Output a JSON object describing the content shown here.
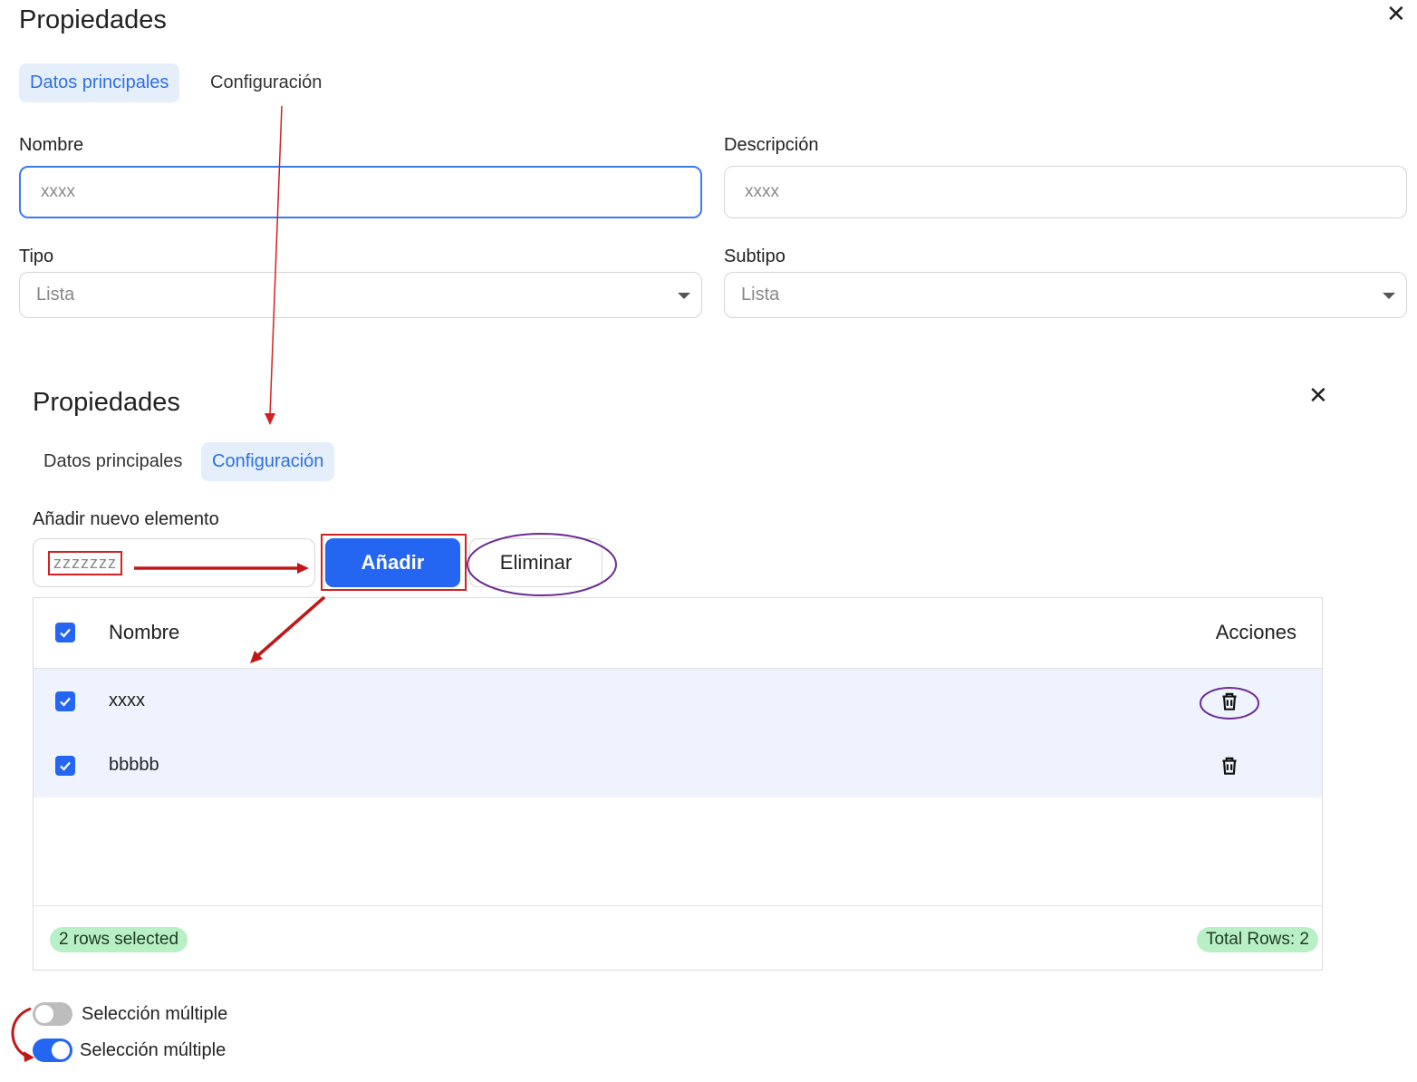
{
  "top_panel": {
    "title": "Propiedades",
    "close_icon": "close-icon",
    "tabs": [
      {
        "label": "Datos principales",
        "active": true
      },
      {
        "label": "Configuración",
        "active": false
      }
    ],
    "fields": {
      "nombre_label": "Nombre",
      "nombre_placeholder": "xxxx",
      "descripcion_label": "Descripción",
      "descripcion_placeholder": "xxxx",
      "tipo_label": "Tipo",
      "tipo_value": "Lista",
      "subtipo_label": "Subtipo",
      "subtipo_value": "Lista"
    }
  },
  "bottom_panel": {
    "title": "Propiedades",
    "close_icon": "close-icon",
    "tabs": [
      {
        "label": "Datos principales",
        "active": false
      },
      {
        "label": "Configuración",
        "active": true
      }
    ],
    "add_label": "Añadir nuevo elemento",
    "add_input_value": "zzzzzzz",
    "add_button": "Añadir",
    "delete_button": "Eliminar",
    "table": {
      "headers": {
        "name": "Nombre",
        "actions": "Acciones"
      },
      "rows": [
        {
          "name": "xxxx",
          "checked": true,
          "action_icon": "trash-icon"
        },
        {
          "name": "bbbbb",
          "checked": true,
          "action_icon": "trash-icon"
        }
      ],
      "footer": {
        "selected": "2 rows selected",
        "total": "Total Rows: 2"
      }
    },
    "toggles": [
      {
        "label": "Selección múltiple",
        "state": "off"
      },
      {
        "label": "Selección múltiple",
        "state": "on"
      }
    ]
  },
  "colors": {
    "accent": "#2466f2",
    "active_tab_bg": "#e5effc",
    "row_selected_bg": "#eef3fd",
    "pill_bg": "#b9efc4",
    "annotation_red": "#d32020",
    "annotation_purple": "#6a2c91"
  }
}
